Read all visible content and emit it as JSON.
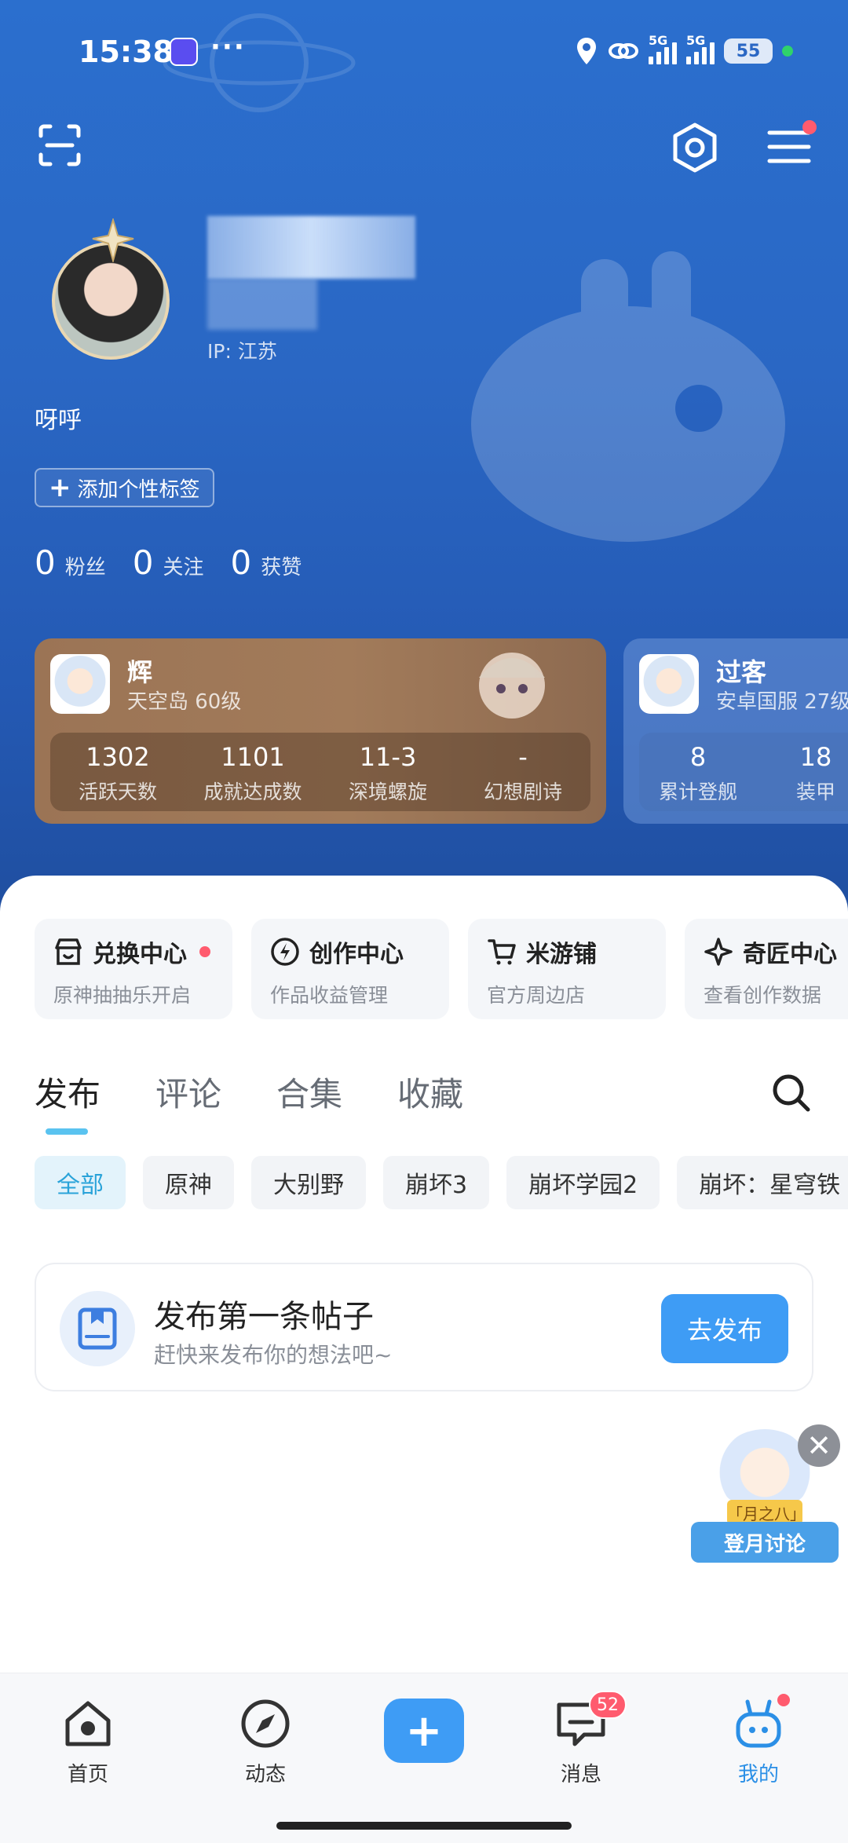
{
  "status_bar": {
    "time": "15:38",
    "dots": "···",
    "network_1": "5G",
    "network_2": "5G",
    "battery": "55"
  },
  "profile": {
    "ip_label": "IP: 江苏",
    "bio": "呀呼",
    "add_tag_label": "添加个性标签",
    "stats": [
      {
        "value": "0",
        "label": "粉丝"
      },
      {
        "value": "0",
        "label": "关注"
      },
      {
        "value": "0",
        "label": "获赞"
      }
    ]
  },
  "game_cards": [
    {
      "name": "辉",
      "server_level": "天空岛 60级",
      "stats": [
        {
          "value": "1302",
          "label": "活跃天数"
        },
        {
          "value": "1101",
          "label": "成就达成数"
        },
        {
          "value": "11-3",
          "label": "深境螺旋"
        },
        {
          "value": "-",
          "label": "幻想剧诗"
        }
      ]
    },
    {
      "name": "过客",
      "server_level": "安卓国服 27级",
      "stats": [
        {
          "value": "8",
          "label": "累计登舰"
        },
        {
          "value": "18",
          "label": "装甲"
        }
      ]
    }
  ],
  "shortcuts": [
    {
      "title": "兑换中心",
      "subtitle": "原神抽抽乐开启",
      "icon": "store-icon"
    },
    {
      "title": "创作中心",
      "subtitle": "作品收益管理",
      "icon": "lightning-icon"
    },
    {
      "title": "米游铺",
      "subtitle": "官方周边店",
      "icon": "cart-icon"
    },
    {
      "title": "奇匠中心",
      "subtitle": "查看创作数据",
      "icon": "sparkle-icon"
    }
  ],
  "tabs": [
    "发布",
    "评论",
    "合集",
    "收藏"
  ],
  "filters": [
    "全部",
    "原神",
    "大别野",
    "崩坏3",
    "崩坏学园2",
    "崩坏：星穹铁"
  ],
  "empty_post": {
    "title": "发布第一条帖子",
    "subtitle": "赶快来发布你的想法吧~",
    "button": "去发布"
  },
  "float_ad": {
    "tag": "「月之八」",
    "banner": "登月讨论"
  },
  "nav": [
    {
      "label": "首页",
      "icon": "home-icon"
    },
    {
      "label": "动态",
      "icon": "compass-icon"
    },
    {
      "label": "消息",
      "icon": "message-icon",
      "badge": "52"
    },
    {
      "label": "我的",
      "icon": "profile-bot-icon"
    }
  ],
  "colors": {
    "hero_blue": "#2a67c4",
    "accent_blue": "#3e9cf5",
    "badge_red": "#ff5b6e",
    "filter_active": "#2aa3d9"
  }
}
